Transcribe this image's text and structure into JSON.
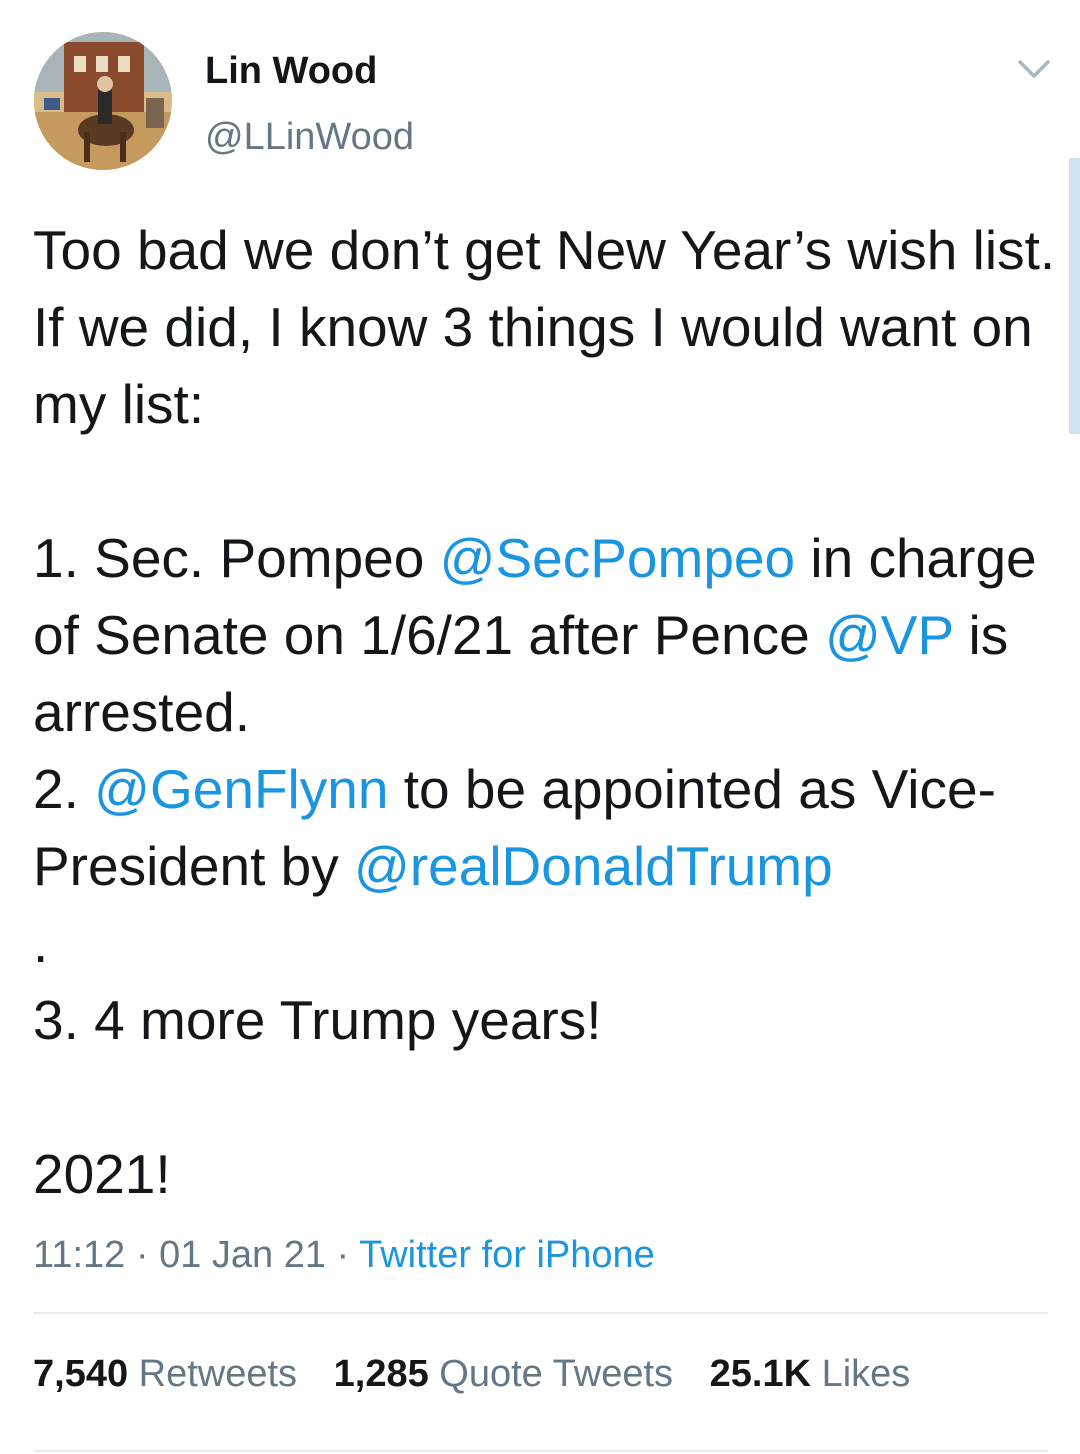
{
  "author": {
    "display_name": "Lin Wood",
    "handle": "@LLinWood",
    "avatar_icon": "avatar-portrait-horse-rider"
  },
  "menu": {
    "icon": "chevron-down-icon"
  },
  "tweet": {
    "segments": [
      {
        "type": "text",
        "text": "Too bad we don’t get New Year’s wish list. If we did, I know 3 things I would want on my list:\n\n1. Sec. Pompeo "
      },
      {
        "type": "mention",
        "text": "@SecPompeo"
      },
      {
        "type": "text",
        "text": " in charge of Senate on 1/6/21 after Pence "
      },
      {
        "type": "mention",
        "text": "@VP"
      },
      {
        "type": "text",
        "text": " is arrested.\n2. "
      },
      {
        "type": "mention",
        "text": "@GenFlynn"
      },
      {
        "type": "text",
        "text": " to be appointed as Vice-President by "
      },
      {
        "type": "mention",
        "text": "@realDonaldTrump"
      },
      {
        "type": "text",
        "text": "\n.\n3. 4 more Trump years!\n\n2021!"
      }
    ]
  },
  "meta": {
    "time": "11:12",
    "separator": "·",
    "date": "01 Jan 21",
    "source": "Twitter for iPhone"
  },
  "stats": {
    "retweets_count": "7,540",
    "retweets_label": "Retweets",
    "quotes_count": "1,285",
    "quotes_label": "Quote Tweets",
    "likes_count": "25.1K",
    "likes_label": "Likes"
  },
  "colors": {
    "text": "#14171a",
    "secondary": "#657786",
    "link": "#1b95e0",
    "divider": "#e6ecf0"
  }
}
